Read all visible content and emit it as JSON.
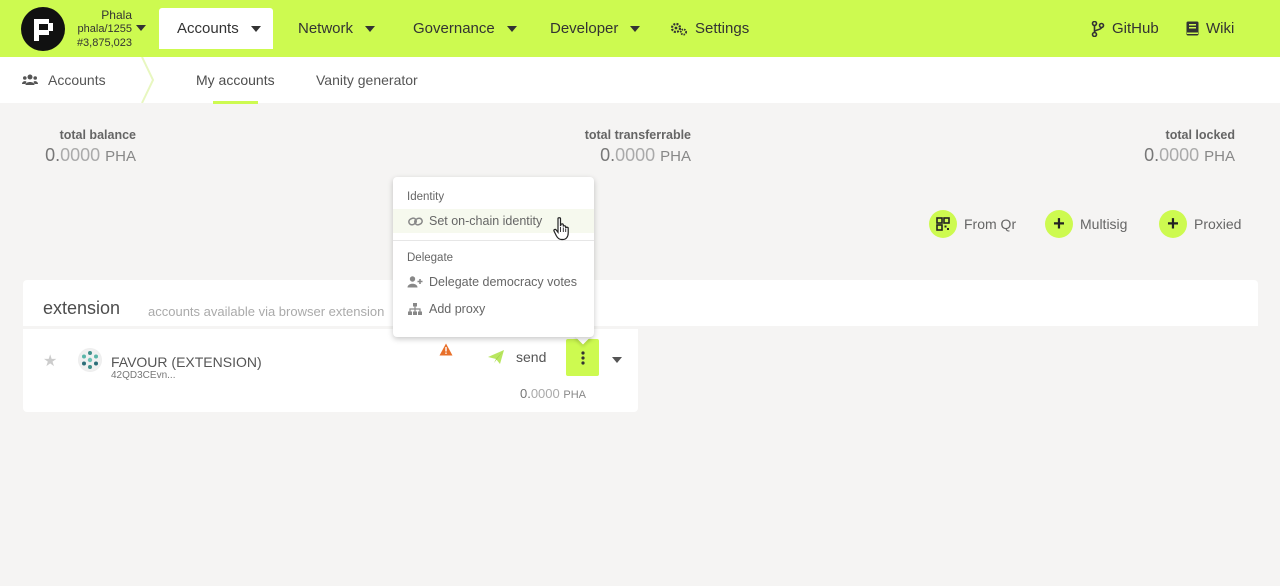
{
  "chain": {
    "name": "Phala",
    "version": "phala/1255",
    "block": "#3,875,023"
  },
  "nav": {
    "accounts": "Accounts",
    "network": "Network",
    "governance": "Governance",
    "developer": "Developer",
    "settings": "Settings",
    "github": "GitHub",
    "wiki": "Wiki"
  },
  "subnav": {
    "section": "Accounts",
    "tab_my_accounts": "My accounts",
    "tab_vanity": "Vanity generator"
  },
  "balances": {
    "total_balance": {
      "label": "total balance",
      "int": "0.",
      "dec": "0000",
      "unit": "PHA"
    },
    "total_transferrable": {
      "label": "total transferrable",
      "int": "0.",
      "dec": "0000",
      "unit": "PHA"
    },
    "total_locked": {
      "label": "total locked",
      "int": "0.",
      "dec": "0000",
      "unit": "PHA"
    }
  },
  "actions": {
    "from_qr": "From Qr",
    "multisig": "Multisig",
    "proxied": "Proxied"
  },
  "extension": {
    "title": "extension",
    "subtitle": "accounts available via browser extension"
  },
  "account": {
    "name": "FAVOUR (EXTENSION)",
    "address": "42QD3CEvn...",
    "send": "send",
    "bal_int": "0.",
    "bal_dec": "0000",
    "bal_unit": "PHA"
  },
  "popup": {
    "identity_heading": "Identity",
    "set_identity": "Set on-chain identity",
    "delegate_heading": "Delegate",
    "delegate_votes": "Delegate democracy votes",
    "add_proxy": "Add proxy"
  },
  "colors": {
    "accent": "#cdfa50",
    "warning": "#e8702a"
  }
}
